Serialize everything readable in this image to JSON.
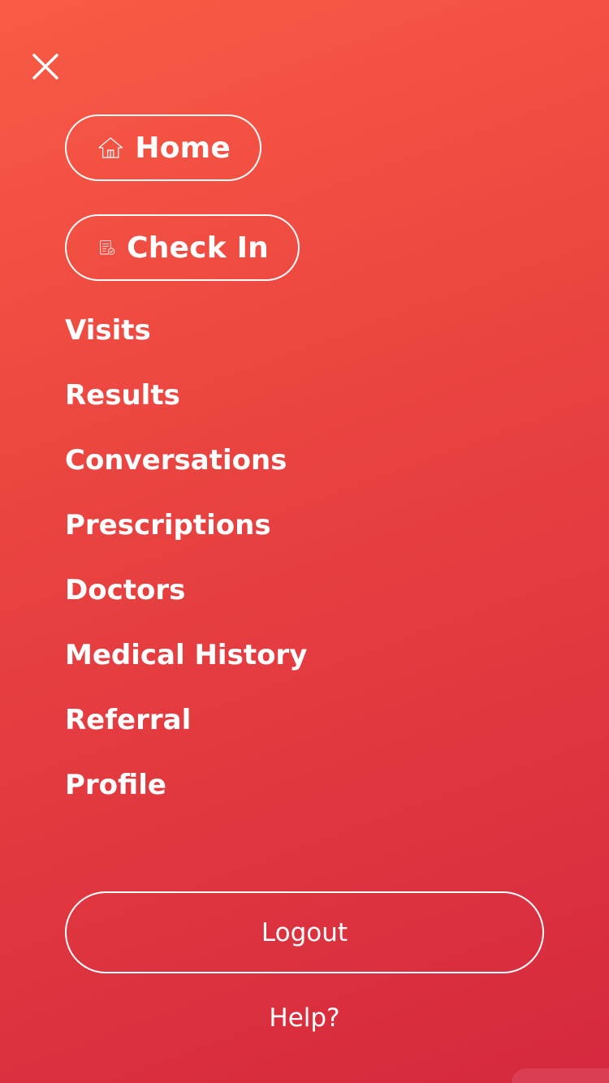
{
  "header": {
    "close_icon": "close-icon"
  },
  "primary": {
    "home": {
      "label": "Home",
      "icon": "house-icon"
    },
    "check_in": {
      "label": "Check In",
      "icon": "checklist-document-icon"
    }
  },
  "menu": {
    "items": [
      {
        "label": "Visits"
      },
      {
        "label": "Results"
      },
      {
        "label": "Conversations"
      },
      {
        "label": "Prescriptions"
      },
      {
        "label": "Doctors"
      },
      {
        "label": "Medical History"
      },
      {
        "label": "Referral"
      },
      {
        "label": "Profile"
      }
    ]
  },
  "footer": {
    "logout_label": "Logout",
    "help_label": "Help?"
  },
  "colors": {
    "background_top": "#f95b45",
    "background_bottom": "#d5283f",
    "foreground": "#ffffff"
  }
}
